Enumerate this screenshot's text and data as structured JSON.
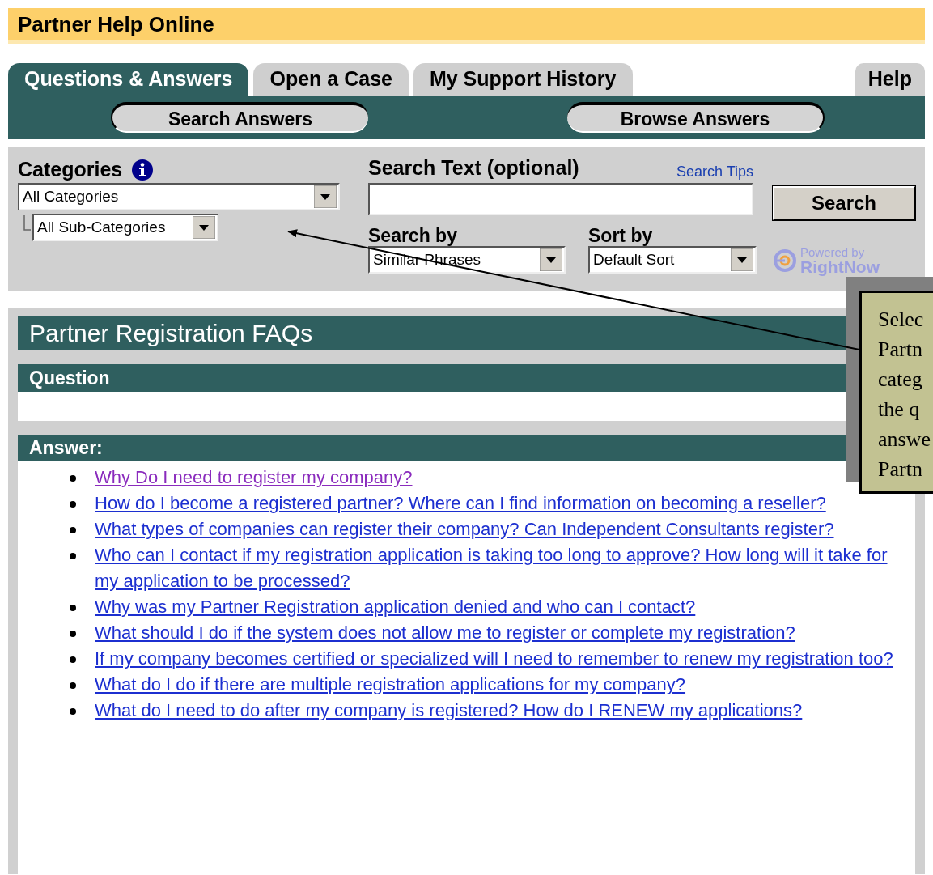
{
  "header": {
    "title": "Partner Help Online"
  },
  "tabs": [
    {
      "label": "Questions & Answers",
      "selected": true
    },
    {
      "label": "Open a Case",
      "selected": false
    },
    {
      "label": "My Support History",
      "selected": false
    },
    {
      "label": "Help",
      "selected": false
    }
  ],
  "subtabs": [
    "Search Answers",
    "Browse Answers"
  ],
  "search_panel": {
    "categories_label": "Categories",
    "category": "All Categories",
    "subcategory": "All Sub-Categories",
    "search_text_label": "Search Text (optional)",
    "search_tips": "Search Tips",
    "search_button": "Search",
    "search_by_label": "Search by",
    "search_by": "Similar Phrases",
    "sort_by_label": "Sort by",
    "sort_by": "Default Sort",
    "powered_by": "Powered by",
    "brand": "RightNow"
  },
  "section": {
    "title": "Partner Registration FAQs",
    "question_label": "Question",
    "answer_label": "Answer:"
  },
  "answers": [
    {
      "text": "Why Do I need to register my company?",
      "visited": true
    },
    {
      "text": "How do I become a registered partner? Where can I find information on becoming a reseller?",
      "visited": false
    },
    {
      "text": "What types of companies can register their company? Can Independent Consultants register?",
      "visited": false
    },
    {
      "text": "Who can I contact if my registration application is taking too long to approve? How long will it take for my application to be processed?",
      "visited": false
    },
    {
      "text": "Why was my Partner Registration application denied and who can I contact?",
      "visited": false
    },
    {
      "text": "What should I do if the system does not allow me to register or complete my registration?",
      "visited": false
    },
    {
      "text": "If my company becomes certified or specialized will I need to remember to renew my registration too?",
      "visited": false
    },
    {
      "text": "What do I do if there are multiple registration applications for my company?",
      "visited": false
    },
    {
      "text": "What do I need to do after my company is registered? How do I RENEW my applications?",
      "visited": false
    }
  ],
  "callout": {
    "lines": [
      "Selec",
      "Partn",
      "categ",
      "the q",
      "answe",
      "Partn"
    ]
  }
}
